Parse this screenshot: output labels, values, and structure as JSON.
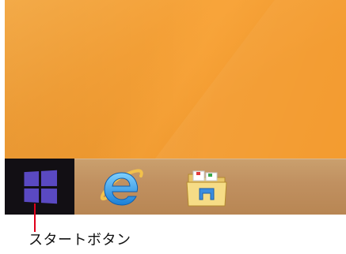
{
  "taskbar": {
    "start_button": {
      "icon": "windows-logo-icon",
      "color": "#5a49c2"
    },
    "pinned": [
      {
        "icon": "internet-explorer-icon"
      },
      {
        "icon": "file-explorer-icon"
      }
    ]
  },
  "desktop": {
    "background_color": "#f39b2f"
  },
  "annotation": {
    "caption": "スタートボタン",
    "line_color": "#e0001a"
  }
}
